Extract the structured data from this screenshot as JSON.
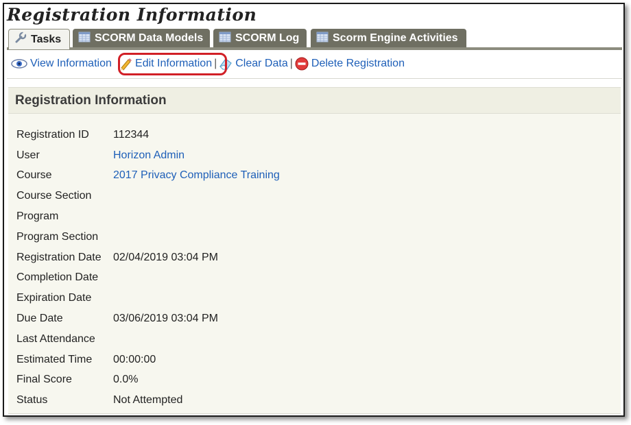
{
  "page": {
    "title": "Registration Information"
  },
  "tabs": [
    {
      "label": "Tasks",
      "icon": "wrench-icon",
      "active": true
    },
    {
      "label": "SCORM Data Models",
      "icon": "table-icon",
      "active": false
    },
    {
      "label": "SCORM Log",
      "icon": "table-icon",
      "active": false
    },
    {
      "label": "Scorm Engine Activities",
      "icon": "table-icon",
      "active": false
    }
  ],
  "toolbar": {
    "view": "View Information",
    "edit": "Edit Information",
    "clear": "Clear Data",
    "delete": "Delete Registration",
    "separator": "|"
  },
  "panel": {
    "title": "Registration Information",
    "rows": [
      {
        "label": "Registration ID",
        "value": "112344",
        "link": false
      },
      {
        "label": "User",
        "value": "Horizon Admin",
        "link": true
      },
      {
        "label": "Course",
        "value": "2017 Privacy Compliance Training",
        "link": true
      },
      {
        "label": "Course Section",
        "value": "",
        "link": false
      },
      {
        "label": "Program",
        "value": "",
        "link": false
      },
      {
        "label": "Program Section",
        "value": "",
        "link": false
      },
      {
        "label": "Registration Date",
        "value": "02/04/2019 03:04 PM",
        "link": false
      },
      {
        "label": "Completion Date",
        "value": "",
        "link": false
      },
      {
        "label": "Expiration Date",
        "value": "",
        "link": false
      },
      {
        "label": "Due Date",
        "value": "03/06/2019 03:04 PM",
        "link": false
      },
      {
        "label": "Last Attendance",
        "value": "",
        "link": false
      },
      {
        "label": "Estimated Time",
        "value": "00:00:00",
        "link": false
      },
      {
        "label": "Final Score",
        "value": "0.0%",
        "link": false
      },
      {
        "label": "Status",
        "value": "Not Attempted",
        "link": false
      }
    ]
  },
  "colors": {
    "link": "#1e5fb8",
    "highlight_ring": "#d11f26",
    "inactive_tab": "#6f6f62",
    "panel_bg": "#f7f7ef"
  }
}
